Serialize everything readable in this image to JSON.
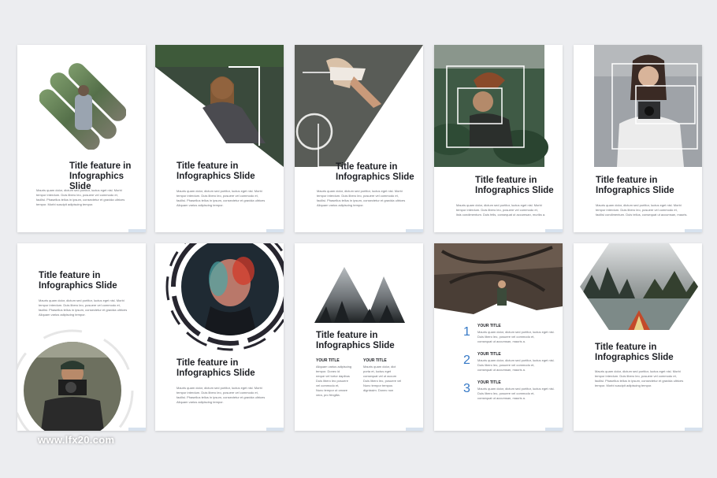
{
  "watermark": "www.lfx20.com",
  "slides": [
    {
      "title": "Title feature in\nInfographics Slide",
      "body": "Mauris quam dolor, dictum sed portitor, luctus eget nisl. Morbi\ntempor interdum. Duis libero leo, posuere vel commodo et,\nfacilisi. Phasellus tellus in ipsum, consectetur et gravida ultrices\ntempor. Morbi suscipit adipiscing tempor."
    },
    {
      "title": "Title feature in\nInfographics Slide",
      "body": "Mauris quam dolor, dictum sed portitor, luctus eget nisl. Morbi\ntempor interdum. Duis libero leo, posuere vel commodo et,\nfacilisi. Phasellus tellus in ipsum, consectetur et gravida ultrices\nAliquam varius adipiscing tempor."
    },
    {
      "title": "Title feature in\nInfographics Slide",
      "body": "Mauris quam dolor, dictum sed portitor, luctus eget nisl. Morbi\ntempor interdum. Duis libero leo, posuere vel commodo et,\nfacilisi. Phasellus tellus in ipsum, consectetur et gravida ultrices\nAliquam varius adipiscing tempor."
    },
    {
      "title": "Title feature in\nInfographics Slide",
      "body": "Mauris quam dolor, dictum sed portitor, luctus eget nisl. Morbi\ntempor interdum. Duis libero leo, posuere vel commodo et,\nlisis condimentum. Duis felis, consequat ut accumsan, muriks a."
    },
    {
      "title": "Title feature in\nInfographics Slide",
      "body": "Mauris quam dolor, dictum sed portitor, luctus eget nisl. Morbi\ntempor interdum. Duis libero leo, posuere vel commodo et,\nfacilisi condimentum. Duis tellus, consequat ut accumsan, mauris."
    },
    {
      "title": "Title feature in\nInfographics Slide",
      "body": "Mauris quam dolor, dictum sed portitor, luctus eget nisl. Morbi\ntempor interdum. Duis libero leo, posuere vel commodo et,\nfacilisi. Phasellus tellus in ipsum, consectetur et gravida ultrices\nAliquam varius adipiscing tempor."
    },
    {
      "title": "Title feature in\nInfographics Slide",
      "body": "Mauris quam dolor, dictum sed portitor, luctus eget nisl. Morbi\ntempor interdum. Duis libero leo, posuere vel commodo et,\nfacilisi. Phasellus tellus in ipsum, consectetur et gravida ultrices\nAliquam varius adipiscing tempor."
    },
    {
      "title": "Title feature in\nInfographics Slide",
      "columns": [
        {
          "heading": "YOUR TITLE",
          "body": "Aliquam varius adipiscing\ntempor. Donec id\nneque vel tortor dapibus\nDuis libero leo posuere\nvel commodo et,\nNunc tempor ut ornare\nvera, pro fringilla."
        },
        {
          "heading": "YOUR TITLE",
          "body": "Mauris quam dolor, dict\nporta et, luctus eget\nconsequat vel ut accum\nDuis libero leo, posuere vel\nNunc tempor tempus\ndignissim. Donec non"
        }
      ]
    },
    {
      "items": [
        {
          "number": "1",
          "heading": "YOUR TITLE",
          "body": "Mauris quam dolor, dictum sed portitor, luctus eget nisl.\nDuis libero leo, posuere vel commodo et,\nconsequat ut accumsan, mauris a."
        },
        {
          "number": "2",
          "heading": "YOUR TITLE",
          "body": "Mauris quam dolor, dictum sed portitor, luctus eget nisl.\nDuis libero leo, posuere vel commodo et,\nconsequat ut accumsan, mauris a."
        },
        {
          "number": "3",
          "heading": "YOUR TITLE",
          "body": "Mauris quam dolor, dictum sed portitor, luctus eget nisl.\nDuis libero leo, posuere vel commodo et,\nconsequat ut accumsan, mauris a."
        }
      ]
    },
    {
      "title": "Title feature in\nInfographics Slide",
      "body": "Mauris quam dolor, dictum sed portitor, luctus eget nisl. Morbi\ntempor interdum. Duis libero leo, posuere vel commodo et,\nfacilisi. Phasellus tellus in ipsum, consectetur et gravida ultrices\ntempor. Morbi suscipit adipiscing tempor."
    }
  ],
  "colors": {
    "accent": "#3478c6",
    "text_dark": "#1d1f24",
    "text_body": "#6b6e75",
    "background": "#ecedf0"
  }
}
